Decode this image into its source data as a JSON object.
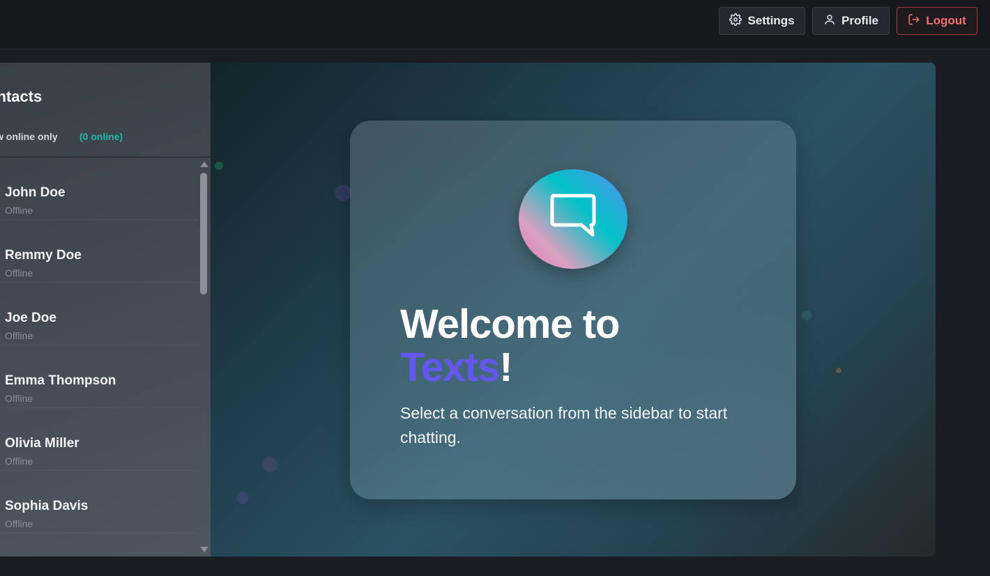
{
  "topbar": {
    "settings_label": "Settings",
    "profile_label": "Profile",
    "logout_label": "Logout"
  },
  "sidebar": {
    "title": "ontacts",
    "online_toggle_label": "w online only",
    "online_count": "(0 online)",
    "contacts": [
      {
        "name": "John Doe",
        "status": "Offline"
      },
      {
        "name": "Remmy Doe",
        "status": "Offline"
      },
      {
        "name": "Joe Doe",
        "status": "Offline"
      },
      {
        "name": "Emma Thompson",
        "status": "Offline"
      },
      {
        "name": "Olivia Miller",
        "status": "Offline"
      },
      {
        "name": "Sophia Davis",
        "status": "Offline"
      }
    ]
  },
  "welcome": {
    "title_line1": "Welcome to",
    "brand": "Texts",
    "exclaim": "!",
    "subtitle": "Select a conversation from the sidebar to start chatting."
  },
  "colors": {
    "accent": "#6457f0",
    "online": "#22b8a6",
    "logout": "#f27171"
  }
}
